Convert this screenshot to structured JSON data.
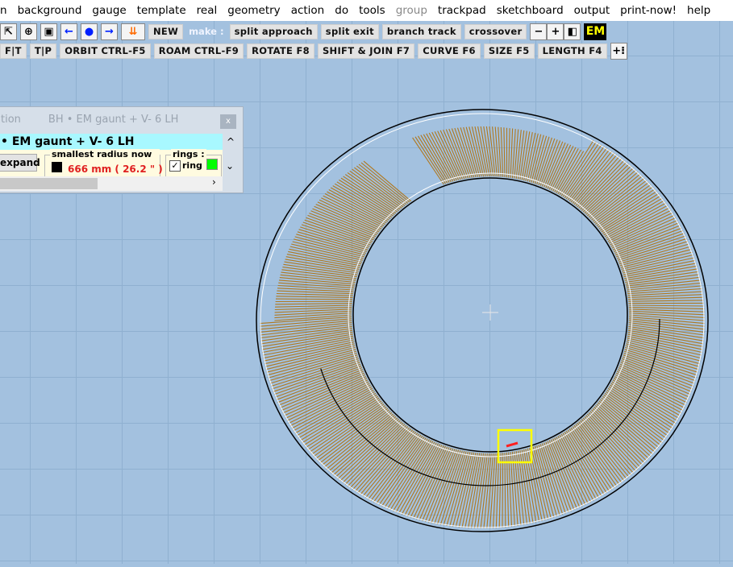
{
  "menu": [
    "n",
    "background",
    "gauge",
    "template",
    "real",
    "geometry",
    "action",
    "do",
    "tools",
    "group",
    "trackpad",
    "sketchboard",
    "output",
    "print-now!",
    "help"
  ],
  "toolbar1": {
    "new_label": "NEW",
    "make_label": "make :",
    "buttons": [
      "split  approach",
      "split  exit",
      "branch  track",
      "crossover"
    ],
    "minus": "−",
    "plus": "+",
    "em_label": "EM"
  },
  "toolbar2": {
    "buttons": [
      "F|T",
      "T|P",
      "ORBIT  CTRL-F5",
      "ROAM  CTRL-F9",
      "ROTATE  F8",
      "SHIFT & JOIN  F7",
      "CURVE  F6",
      "SIZE  F5",
      "LENGTH  F4"
    ]
  },
  "panel": {
    "title_left": "tion",
    "title": "BH • EM  gaunt  +  V- 6   LH",
    "close": "x",
    "heading": "• EM  gaunt  +  V- 6   LH",
    "expand": "expand",
    "radius_legend": "smallest  radius  now :",
    "radius_value": "666 mm ( 26.2 \" )",
    "rings_legend": "rings :",
    "ring_label": "ring",
    "ring_checked": true,
    "ring_color": "#00ff00"
  },
  "colors": {
    "timber": "#b0781e",
    "background": "#a3c1df",
    "highlight": "#ffff00"
  }
}
